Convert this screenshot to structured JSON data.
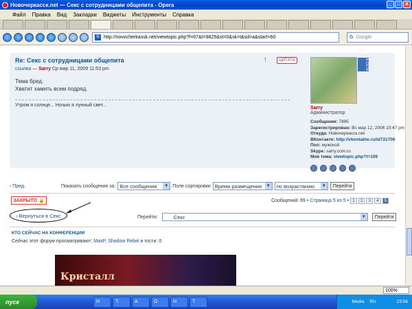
{
  "window": {
    "title": "Новочеркасск.net — Секс с сотрудницами общепита - Opera",
    "controls": [
      "_",
      "□",
      "X"
    ]
  },
  "menu": [
    "Файл",
    "Правка",
    "Вид",
    "Закладки",
    "Виджеты",
    "Инструменты",
    "Справка"
  ],
  "address": {
    "url": "http://novocherkassk.net/viewtopic.php?f=67&t=9825&st=0&sk=t&sd=a&start=60",
    "favicon": "N",
    "search_engine": "G",
    "search_placeholder": "Google"
  },
  "post": {
    "title": "Re: Секс с сотрудницами общепита",
    "meta_link": "ссылка",
    "meta_sep": " — ",
    "author": "Sarry",
    "date": " Ср мар 11, 2009 11:53 pm",
    "body_line1": "Тема бред.",
    "body_line2": "Хватит хамить всем подряд.",
    "signature": "Утром я солнце... Ночью я лунный свет...",
    "warn_icon": "!",
    "quote_label": "ЦИТАТА"
  },
  "profile": {
    "online_badge": "В СЕТИ",
    "name": "Sarry",
    "role": "Администратор",
    "messages_label": "Сообщения:",
    "messages": "7895",
    "registered_label": "Зарегистрирован:",
    "registered": "Вс мар 12, 2006 10:47 pm",
    "from_label": "Откуда:",
    "from": "Новочеркасск.net",
    "vk_label": "ВКонтакте:",
    "vk": "http://vkontakte.ru/id731700",
    "gender_label": "Пол:",
    "gender": "мужской",
    "skype_label": "Skype:",
    "skype": "sarry.com.ru",
    "mytopic_label": "Моя тема:",
    "mytopic": "viewtopic.php?t=109"
  },
  "topic_nav": {
    "prev": "‹ Пред.",
    "show_label": "Показать сообщения за:",
    "show_value": "Все сообщения",
    "sort_label": "Поле сортировки",
    "sort_value": "Время размещения",
    "order_value": "по возрастанию",
    "go": "Перейти"
  },
  "locked_label": "ЗАКРЫТО",
  "pagination": {
    "count": "Сообщений: 69",
    "page_text": " • Страница 5 из 5 • ",
    "pages": [
      "1",
      "2",
      "3",
      "4",
      "5"
    ],
    "current": "5"
  },
  "back_link": "‹ Вернуться в Секс",
  "jump": {
    "label": "Перейти:",
    "value": "Секс",
    "go": "Перейти"
  },
  "who": {
    "heading": "КТО СЕЙЧАС НА КОНФЕРЕНЦИИ",
    "prefix": "Сейчас этот форум просматривают: ",
    "user1": "MaxP",
    "sep": ", ",
    "user2": "Shadow Rebel",
    "suffix": " и гости: 0"
  },
  "banner_text": "Кристалл",
  "zoom": "100%",
  "taskbar": {
    "start": "пуск",
    "tasks": [
      "H",
      "T.",
      "A",
      "O",
      "H",
      "T."
    ],
    "tray_text": "Media",
    "lang": "RU",
    "clock": "23:56"
  }
}
